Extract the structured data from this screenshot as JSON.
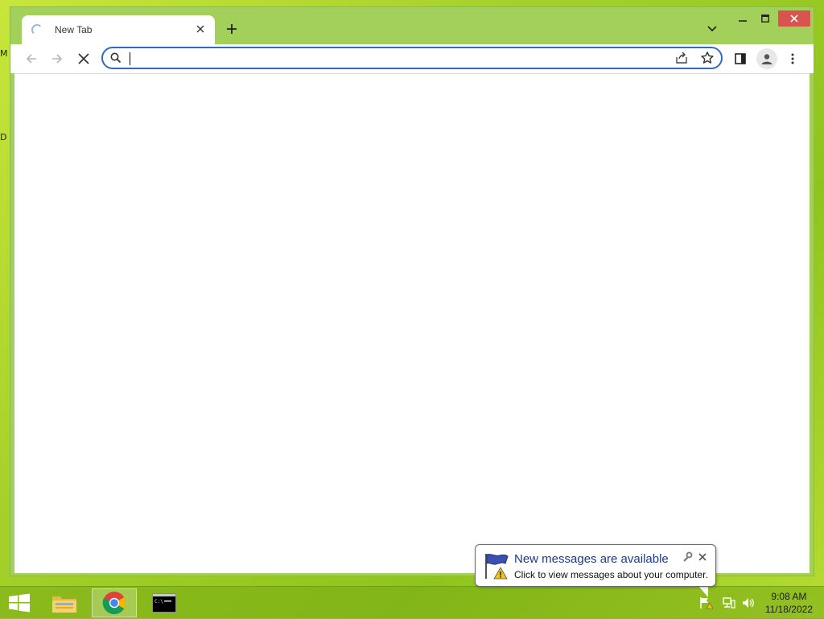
{
  "desktop": {
    "clip_m": "M",
    "clip_d": "D"
  },
  "browser": {
    "tab_title": "New Tab",
    "omnibox_value": "",
    "accent_color": "#2e6cc5",
    "titlebar_color": "#a3cf5b"
  },
  "taskbar": {
    "apps": [
      "file-explorer",
      "chrome",
      "command-prompt"
    ],
    "time": "9:08 AM",
    "date": "11/18/2022"
  },
  "notification": {
    "title": "New messages are available",
    "text": "Click to view messages about your computer."
  }
}
